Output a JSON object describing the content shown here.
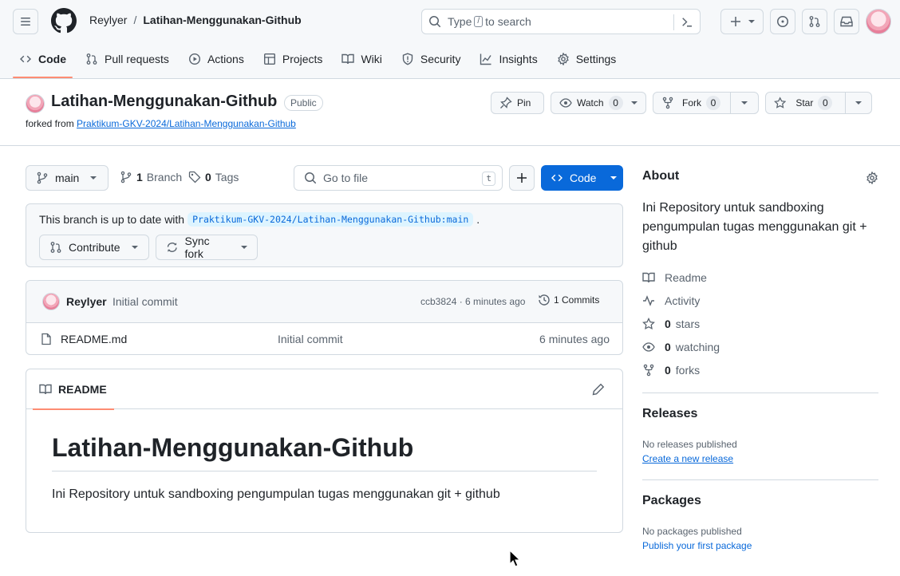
{
  "header": {
    "owner": "Reylyer",
    "separator": "/",
    "repo": "Latihan-Menggunakan-Github",
    "search_prefix": "Type",
    "search_key": "/",
    "search_suffix": "to search"
  },
  "nav": {
    "items": [
      {
        "label": "Code",
        "icon": "code-icon"
      },
      {
        "label": "Pull requests",
        "icon": "git-pull-request-icon"
      },
      {
        "label": "Actions",
        "icon": "play-icon"
      },
      {
        "label": "Projects",
        "icon": "table-icon"
      },
      {
        "label": "Wiki",
        "icon": "book-icon"
      },
      {
        "label": "Security",
        "icon": "shield-icon"
      },
      {
        "label": "Insights",
        "icon": "graph-icon"
      },
      {
        "label": "Settings",
        "icon": "gear-icon"
      }
    ]
  },
  "repo": {
    "name": "Latihan-Menggunakan-Github",
    "visibility": "Public",
    "forked_from_label": "forked from",
    "forked_from": "Praktikum-GKV-2024/Latihan-Menggunakan-Github"
  },
  "actions": {
    "pin": "Pin",
    "watch": "Watch",
    "watch_count": "0",
    "fork": "Fork",
    "fork_count": "0",
    "star": "Star",
    "star_count": "0"
  },
  "toolbar": {
    "branch": "main",
    "branch_count": "1",
    "branch_label": "Branch",
    "tag_count": "0",
    "tag_label": "Tags",
    "go_to_file": "Go to file",
    "go_to_file_key": "t",
    "code_label": "Code"
  },
  "branch_status": {
    "text": "This branch is up to date with",
    "ref": "Praktikum-GKV-2024/Latihan-Menggunakan-Github:main",
    "end": ".",
    "contribute": "Contribute",
    "sync_fork": "Sync fork"
  },
  "latest_commit": {
    "author": "Reylyer",
    "message": "Initial commit",
    "meta": "ccb3824 · 6 minutes ago",
    "commits_label": "1 Commits"
  },
  "files": [
    {
      "name": "README.md",
      "message": "Initial commit",
      "time": "6 minutes ago"
    }
  ],
  "readme": {
    "tab": "README",
    "heading": "Latihan-Menggunakan-Github",
    "body": "Ini Repository untuk sandboxing pengumpulan tugas menggunakan git + github"
  },
  "about": {
    "title": "About",
    "description": "Ini Repository untuk sandboxing pengumpulan tugas menggunakan git + github",
    "readme": "Readme",
    "activity": "Activity",
    "stars_count": "0",
    "stars_label": "stars",
    "watching_count": "0",
    "watching_label": "watching",
    "forks_count": "0",
    "forks_label": "forks"
  },
  "releases": {
    "title": "Releases",
    "none": "No releases published",
    "create": "Create a new release"
  },
  "packages": {
    "title": "Packages",
    "none": "No packages published",
    "publish": "Publish your first package"
  },
  "colors": {
    "accent": "#0969da",
    "nav_underline": "#fd8c73",
    "border": "#d1d9e0"
  }
}
